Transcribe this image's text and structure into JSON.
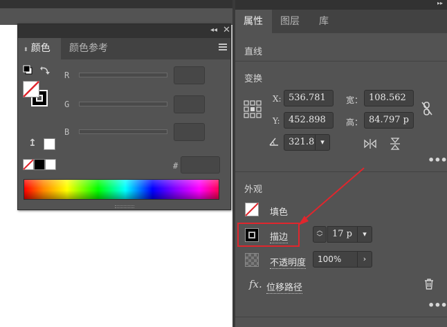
{
  "color_panel": {
    "tabs": [
      {
        "label": "颜色",
        "icon": "updown-arrows-icon"
      },
      {
        "label": "颜色参考"
      }
    ],
    "sliders": [
      {
        "label": "R"
      },
      {
        "label": "G"
      },
      {
        "label": "B"
      }
    ],
    "hex_label": "#"
  },
  "properties": {
    "tabs": [
      {
        "label": "属性"
      },
      {
        "label": "图层"
      },
      {
        "label": "库"
      }
    ],
    "object_type": "直线",
    "transform": {
      "title": "变换",
      "x_label": "X:",
      "x_value": "536.781",
      "y_label": "Y:",
      "y_value": "452.898",
      "w_label": "宽：",
      "w_value": "108.562",
      "h_label": "高：",
      "h_value": "84.797 p",
      "angle_value": "321.8"
    },
    "appearance": {
      "title": "外观",
      "fill_label": "填色",
      "stroke_label": "描边",
      "stroke_weight": "17 p",
      "opacity_label": "不透明度",
      "opacity_value": "100%",
      "effect_label": "位移路径",
      "fx_label": "fx."
    }
  },
  "colors": {
    "annotation": "#e0262d",
    "panel_bg": "#535353",
    "tab_bar": "#424242"
  }
}
